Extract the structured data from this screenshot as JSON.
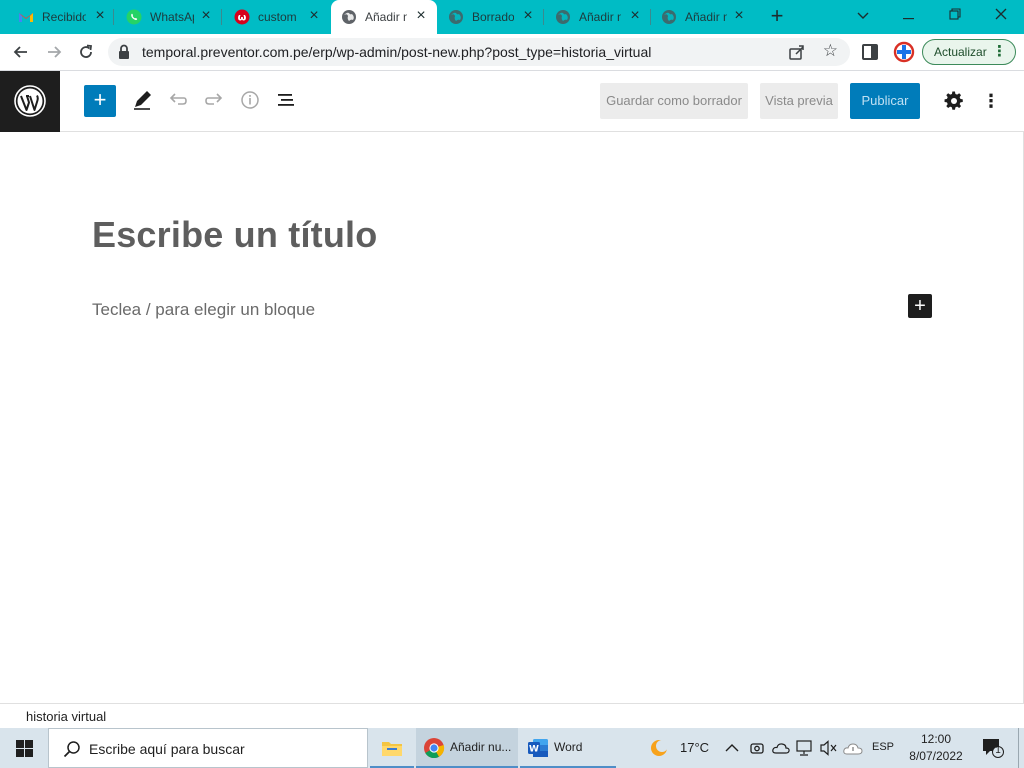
{
  "browser": {
    "tabs": [
      {
        "title": "Recibido",
        "icon": "gmail-icon"
      },
      {
        "title": "WhatsApp",
        "icon": "whatsapp-icon"
      },
      {
        "title": "custom",
        "icon": "customer-app-icon"
      },
      {
        "title": "Añadir n",
        "icon": "globe-icon",
        "active": true
      },
      {
        "title": "Borrado",
        "icon": "globe-icon"
      },
      {
        "title": "Añadir n",
        "icon": "globe-icon"
      },
      {
        "title": "Añadir n",
        "icon": "globe-icon"
      }
    ],
    "url": "temporal.preventor.com.pe/erp/wp-admin/post-new.php?post_type=historia_virtual",
    "update_label": "Actualizar"
  },
  "wp": {
    "toolbar": {
      "save_draft": "Guardar como borrador",
      "preview": "Vista previa",
      "publish": "Publicar"
    },
    "title_placeholder": "Escribe un título",
    "block_placeholder": "Teclea / para elegir un bloque",
    "breadcrumb": "historia virtual"
  },
  "taskbar": {
    "search_placeholder": "Escribe aquí para buscar",
    "apps": [
      {
        "label": "Añadir nu...",
        "icon": "chrome-icon"
      },
      {
        "label": "Word",
        "icon": "word-icon"
      }
    ],
    "weather": "17°C",
    "language": "ESP",
    "time": "12:00",
    "date": "8/07/2022",
    "notification_count": "1"
  },
  "colors": {
    "tab_strip": "#00bcc5",
    "wp_blue": "#007cba",
    "wp_dark": "#1e1e1e"
  }
}
